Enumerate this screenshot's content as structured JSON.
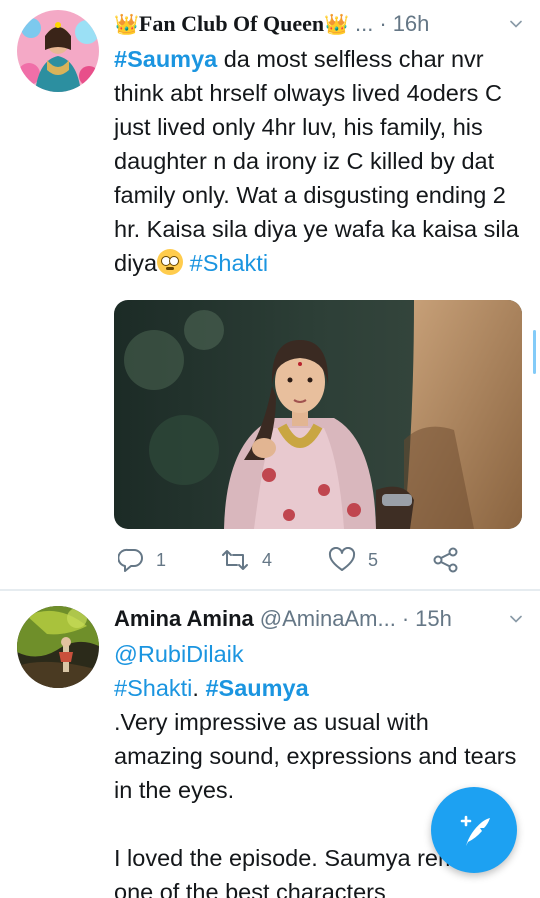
{
  "tweets": [
    {
      "crown_left": "👑",
      "display_name": "Fan Club Of Queen",
      "crown_right": "👑",
      "ellipsis": "...",
      "dot": "·",
      "time": "16h",
      "body": {
        "tag1": "#Saumya",
        "text1": " da most selfless char nvr think abt hrself olways lived 4oders C just lived only 4hr luv, his family, his daughter n da irony iz C killed by dat family only. Wat a disgusting ending 2 hr. Kaisa sila diya ye wafa ka kaisa sila diya",
        "emoji": "face-with-rolling-eyes",
        "tag2": "#Shakti"
      },
      "actions": {
        "reply_count": "1",
        "retweet_count": "4",
        "like_count": "5"
      }
    },
    {
      "display_name": "Amina Amina",
      "handle": "@AminaAm...",
      "dot": "·",
      "time": "15h",
      "body": {
        "mention": "@RubiDilaik",
        "tag1": "#Shakti",
        "sep": ". ",
        "tag2": "#Saumya",
        "para1": ".Very impressive as usual with amazing sound, expressions and tears in the eyes.",
        "para2": "I loved the episode.  Saumya remain one of the best characters"
      }
    }
  ],
  "colors": {
    "link": "#1b95e0",
    "secondary_text": "#657786",
    "fab": "#1da1f2",
    "divider": "#e6ecf0"
  },
  "icons": {
    "reply": "reply-icon",
    "retweet": "retweet-icon",
    "like": "heart-icon",
    "share": "share-icon",
    "caret": "chevron-down-icon",
    "compose": "compose-tweet-icon"
  }
}
